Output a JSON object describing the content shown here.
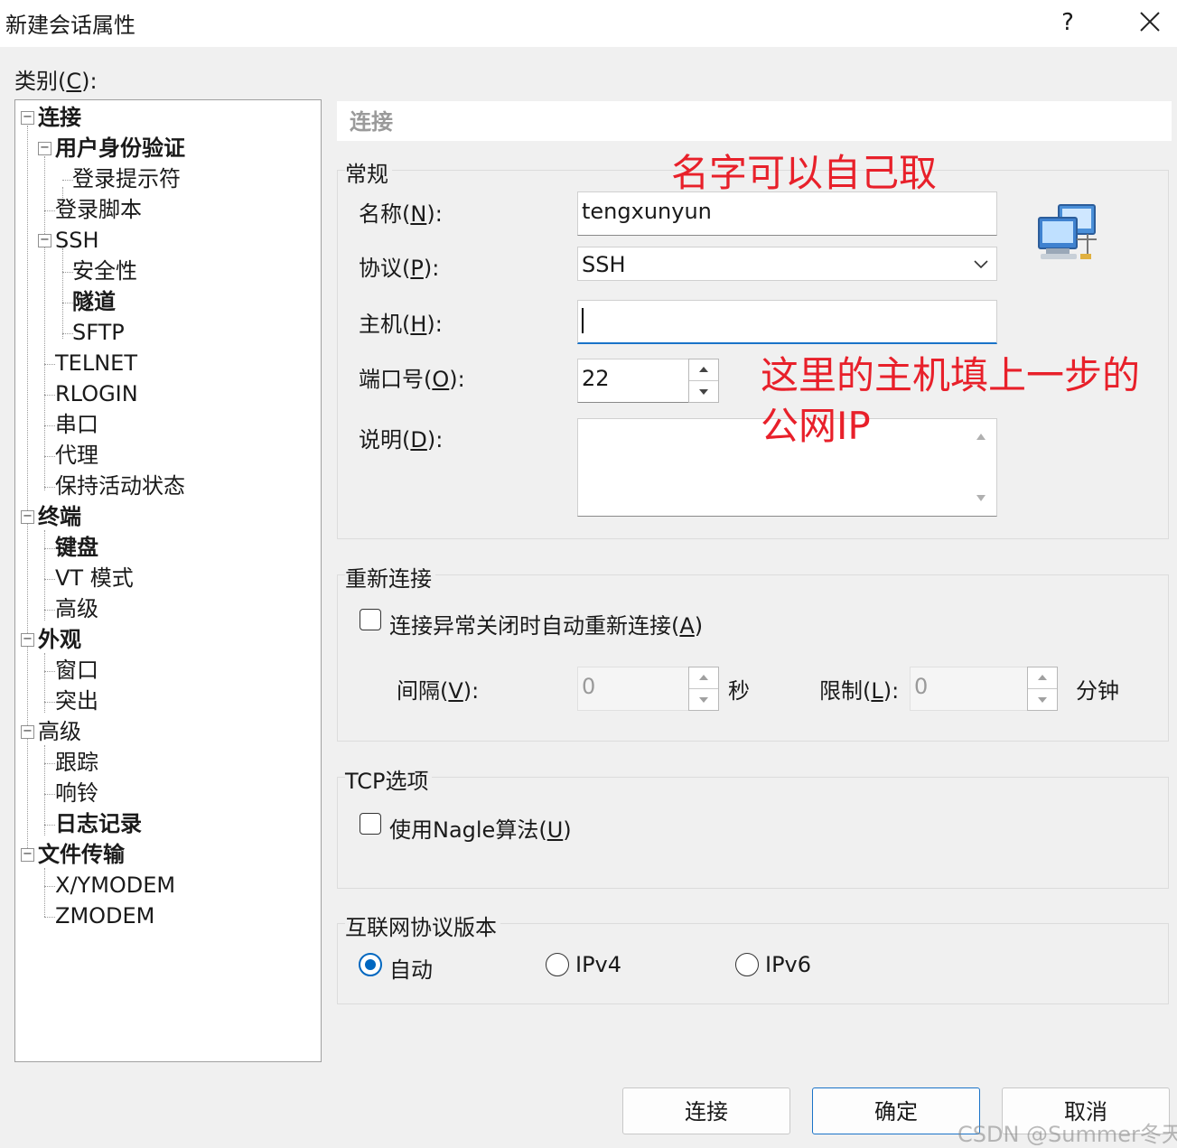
{
  "window": {
    "title": "新建会话属性",
    "help_label": "?"
  },
  "category_label": {
    "text": "类别(",
    "key": "C",
    "suffix": "):"
  },
  "tree": {
    "items": [
      {
        "label": "连接"
      },
      {
        "label": "用户身份验证"
      },
      {
        "label": "登录提示符"
      },
      {
        "label": "登录脚本"
      },
      {
        "label": "SSH"
      },
      {
        "label": "安全性"
      },
      {
        "label": "隧道"
      },
      {
        "label": "SFTP"
      },
      {
        "label": "TELNET"
      },
      {
        "label": "RLOGIN"
      },
      {
        "label": "串口"
      },
      {
        "label": "代理"
      },
      {
        "label": "保持活动状态"
      },
      {
        "label": "终端"
      },
      {
        "label": "键盘"
      },
      {
        "label": "VT 模式"
      },
      {
        "label": "高级"
      },
      {
        "label": "外观"
      },
      {
        "label": "窗口"
      },
      {
        "label": "突出"
      },
      {
        "label": "高级"
      },
      {
        "label": "跟踪"
      },
      {
        "label": "响铃"
      },
      {
        "label": "日志记录"
      },
      {
        "label": "文件传输"
      },
      {
        "label": "X/YMODEM"
      },
      {
        "label": "ZMODEM"
      }
    ],
    "toggle_symbol": "−"
  },
  "panel": {
    "header": "连接",
    "general": {
      "title": "常规",
      "name_label": {
        "text": "名称(",
        "key": "N",
        "suffix": "):"
      },
      "name_value": "tengxunyun",
      "protocol_label": {
        "text": "协议(",
        "key": "P",
        "suffix": "):"
      },
      "protocol_value": "SSH",
      "host_label": {
        "text": "主机(",
        "key": "H",
        "suffix": "):"
      },
      "host_value": "",
      "port_label": {
        "text": "端口号(",
        "key": "O",
        "suffix": "):"
      },
      "port_value": "22",
      "desc_label": {
        "text": "说明(",
        "key": "D",
        "suffix": "):"
      },
      "desc_value": ""
    },
    "reconnect": {
      "title": "重新连接",
      "auto_reconnect": {
        "text": "连接异常关闭时自动重新连接(",
        "key": "A",
        "suffix": ")",
        "checked": false
      },
      "interval_label": {
        "text": "间隔(",
        "key": "V",
        "suffix": "):"
      },
      "interval_value": "0",
      "interval_unit": "秒",
      "limit_label": {
        "text": "限制(",
        "key": "L",
        "suffix": "):"
      },
      "limit_value": "0",
      "limit_unit": "分钟"
    },
    "tcp": {
      "title": "TCP选项",
      "nagle": {
        "text": "使用Nagle算法(",
        "key": "U",
        "suffix": ")",
        "checked": false
      }
    },
    "ip_version": {
      "title": "互联网协议版本",
      "options": [
        "自动",
        "IPv4",
        "IPv6"
      ],
      "selected": "自动"
    }
  },
  "buttons": {
    "connect": "连接",
    "ok": "确定",
    "cancel": "取消"
  },
  "annotations": {
    "name_note": "名字可以自己取",
    "host_note_line1": "这里的主机填上一步的",
    "host_note_line2": "公网IP"
  },
  "watermark": "CSDN @Summer冬天",
  "colors": {
    "annotation": "#e8202a",
    "accent": "#0067c0",
    "focus_underline": "#1a73c8"
  },
  "icons": {
    "session": "network-computers-icon",
    "close": "close-icon",
    "dropdown": "chevron-down-icon"
  }
}
